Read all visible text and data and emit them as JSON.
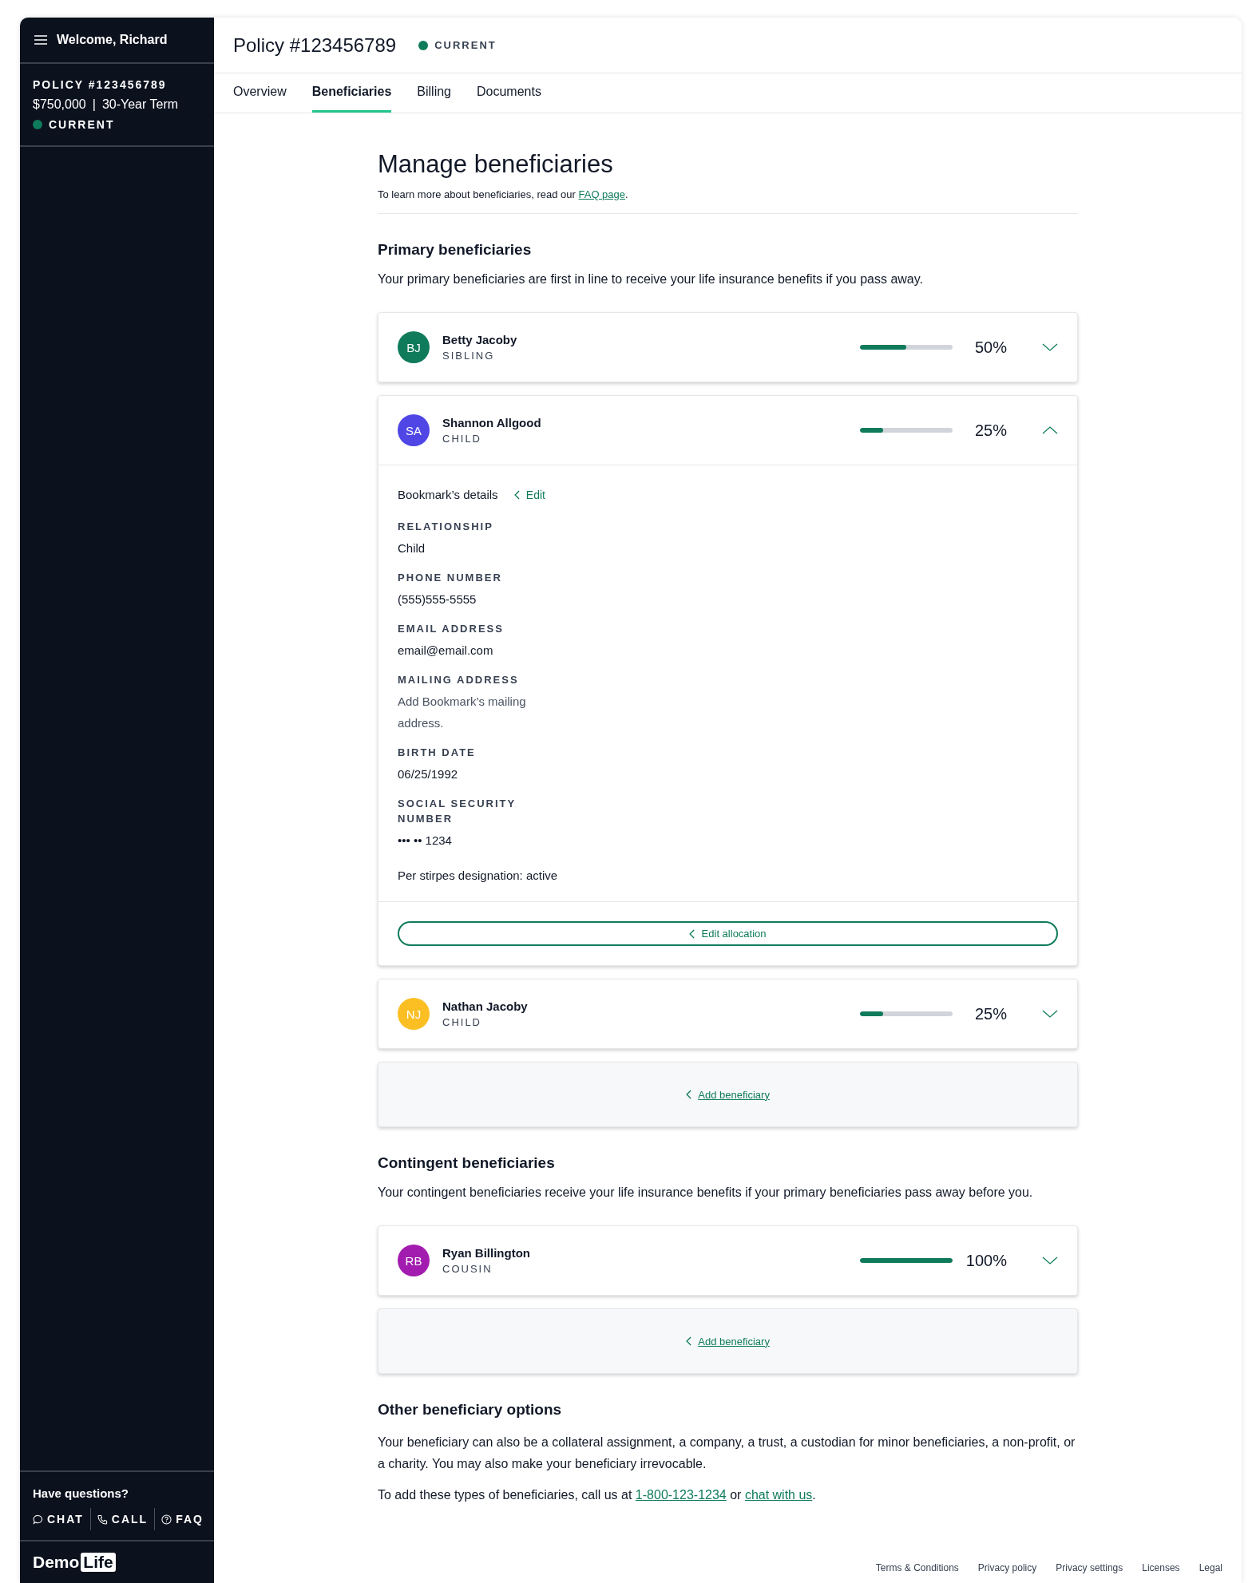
{
  "sidebar": {
    "greeting": "Welcome, Richard",
    "policy_label": "POLICY #123456789",
    "coverage": "$750,000",
    "separator": "|",
    "term": "30-Year Term",
    "status": "CURRENT"
  },
  "help": {
    "title": "Have questions?",
    "actions": [
      {
        "kind": "chat",
        "label": "CHAT"
      },
      {
        "kind": "call",
        "label": "CALL"
      },
      {
        "kind": "faq",
        "label": "FAQ"
      }
    ]
  },
  "logo": {
    "part_1": "Demo",
    "part_2": "Life"
  },
  "header": {
    "title": "Policy #123456789",
    "status": "CURRENT"
  },
  "tabs": [
    {
      "label": "Overview",
      "selected": false
    },
    {
      "label": "Beneficiaries",
      "selected": true
    },
    {
      "label": "Billing",
      "selected": false
    },
    {
      "label": "Documents",
      "selected": false
    }
  ],
  "page": {
    "title": "Manage beneficiaries",
    "intro": "To learn more about beneficiaries, read our",
    "intro_link": "FAQ page",
    "intro_end": "."
  },
  "sections": [
    {
      "title": "Primary beneficiaries",
      "description": "Your primary beneficiaries are first in line to receive your life insurance benefits if you pass away.",
      "add_button": "Add beneficiary",
      "beneficiaries": [
        {
          "initials": "BJ",
          "name": "Betty Jacoby",
          "relationship": "SIBLING",
          "color": "#0f7b5b",
          "level": 0.5,
          "percent": "50%",
          "expanded": false
        },
        {
          "initials": "SA",
          "name": "Shannon Allgood",
          "relationship": "CHILD",
          "color": "#4f46e5",
          "level": 0.25,
          "percent": "25%",
          "expanded": true,
          "details": {
            "heading": "Bookmark’s details",
            "edit_link": "Edit",
            "fields": [
              {
                "kind": "value",
                "label": "RELATIONSHIP",
                "value": "Child"
              },
              {
                "kind": "value",
                "label": "PHONE NUMBER",
                "value": "(555)555-5555"
              },
              {
                "kind": "value",
                "label": "EMAIL ADDRESS",
                "value": "email@email.com"
              },
              {
                "kind": "hint",
                "label": "MAILING ADDRESS",
                "value": "Add Bookmark’s mailing address."
              },
              {
                "kind": "value",
                "label": "BIRTH DATE",
                "value": "06/25/1992"
              },
              {
                "kind": "value",
                "label": "SOCIAL SECURITY NUMBER",
                "value": "••• •• 1234"
              }
            ],
            "per_stirpes": "Per stirpes designation: active",
            "edit_allocation": "Edit allocation"
          }
        },
        {
          "initials": "NJ",
          "name": "Nathan Jacoby",
          "relationship": "CHILD",
          "color": "#fbbf24",
          "level": 0.25,
          "percent": "25%",
          "expanded": false
        }
      ]
    },
    {
      "title": "Contingent beneficiaries",
      "description": "Your contingent beneficiaries receive your life insurance benefits if your primary beneficiaries pass away before you.",
      "add_button": "Add beneficiary",
      "beneficiaries": [
        {
          "initials": "RB",
          "name": "Ryan Billington",
          "relationship": "COUSIN",
          "color": "#a21caf",
          "level": 1,
          "percent": "100%",
          "expanded": false
        }
      ]
    }
  ],
  "other": {
    "title": "Other beneficiary options",
    "paragraph": "Your beneficiary can also be a collateral assignment, a company, a trust, a custodian for minor beneficiaries, a non-profit, or a charity. You may also make your beneficiary irrevocable.",
    "contact_prefix": "To add these types of beneficiaries, call us at",
    "phone": "1-800-123-1234",
    "contact_middle": "or",
    "chat_link": "chat with us",
    "contact_end": "."
  },
  "footer": [
    "Terms & Conditions",
    "Privacy policy",
    "Privacy settings",
    "Licenses",
    "Legal"
  ]
}
